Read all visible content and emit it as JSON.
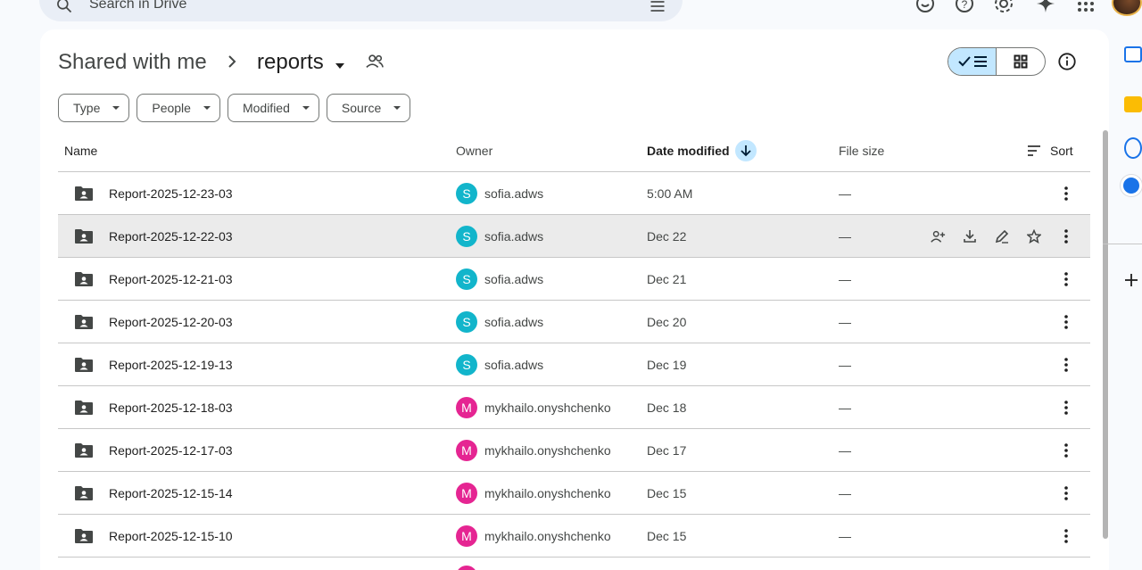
{
  "search": {
    "placeholder": "Search in Drive"
  },
  "breadcrumb": {
    "parent": "Shared with me",
    "current": "reports"
  },
  "filters": [
    "Type",
    "People",
    "Modified",
    "Source"
  ],
  "table": {
    "headers": {
      "name": "Name",
      "owner": "Owner",
      "date": "Date modified",
      "size": "File size",
      "sort": "Sort"
    },
    "rows": [
      {
        "name": "Report-2025-12-23-03",
        "owner_initial": "S",
        "owner": "sofia.adws",
        "owner_color": "#12b5cb",
        "date": "5:00 AM",
        "size": "—"
      },
      {
        "name": "Report-2025-12-22-03",
        "owner_initial": "S",
        "owner": "sofia.adws",
        "owner_color": "#12b5cb",
        "date": "Dec 22",
        "size": "—"
      },
      {
        "name": "Report-2025-12-21-03",
        "owner_initial": "S",
        "owner": "sofia.adws",
        "owner_color": "#12b5cb",
        "date": "Dec 21",
        "size": "—"
      },
      {
        "name": "Report-2025-12-20-03",
        "owner_initial": "S",
        "owner": "sofia.adws",
        "owner_color": "#12b5cb",
        "date": "Dec 20",
        "size": "—"
      },
      {
        "name": "Report-2025-12-19-13",
        "owner_initial": "S",
        "owner": "sofia.adws",
        "owner_color": "#12b5cb",
        "date": "Dec 19",
        "size": "—"
      },
      {
        "name": "Report-2025-12-18-03",
        "owner_initial": "M",
        "owner": "mykhailo.onyshchenko",
        "owner_color": "#e52592",
        "date": "Dec 18",
        "size": "—"
      },
      {
        "name": "Report-2025-12-17-03",
        "owner_initial": "M",
        "owner": "mykhailo.onyshchenko",
        "owner_color": "#e52592",
        "date": "Dec 17",
        "size": "—"
      },
      {
        "name": "Report-2025-12-15-14",
        "owner_initial": "M",
        "owner": "mykhailo.onyshchenko",
        "owner_color": "#e52592",
        "date": "Dec 15",
        "size": "—"
      },
      {
        "name": "Report-2025-12-15-10",
        "owner_initial": "M",
        "owner": "mykhailo.onyshchenko",
        "owner_color": "#e52592",
        "date": "Dec 15",
        "size": "—"
      }
    ]
  },
  "colors": {
    "accent_light": "#c2e7ff",
    "panel": "#ffffff",
    "background": "#f8fafd"
  }
}
